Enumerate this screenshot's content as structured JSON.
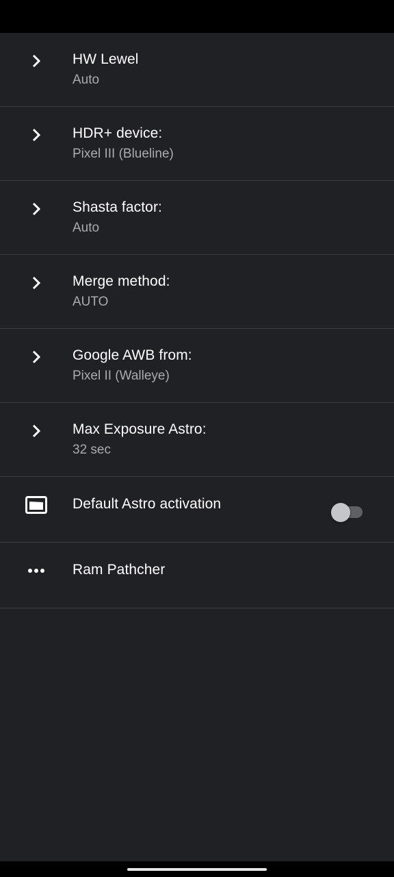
{
  "preferences": [
    {
      "title": "HW Lewel",
      "summary": "Auto",
      "icon": "chevron-right-icon"
    },
    {
      "title": "HDR+ device:",
      "summary": "Pixel III (Blueline)",
      "icon": "chevron-right-icon"
    },
    {
      "title": "Shasta factor:",
      "summary": "Auto",
      "icon": "chevron-right-icon"
    },
    {
      "title": "Merge method:",
      "summary": "AUTO",
      "icon": "chevron-right-icon"
    },
    {
      "title": "Google AWB from:",
      "summary": "Pixel II (Walleye)",
      "icon": "chevron-right-icon"
    },
    {
      "title": "Max Exposure Astro:",
      "summary": "32 sec",
      "icon": "chevron-right-icon"
    },
    {
      "title": "Default Astro activation",
      "icon": "photo-frame-icon",
      "toggle_on": false
    },
    {
      "title": "Ram Pathcher",
      "icon": "more-horiz-icon"
    }
  ],
  "colors": {
    "background": "#202124",
    "divider": "#3c3d40",
    "title_text": "#ffffff",
    "summary_text": "#a8abaf",
    "bars": "#000000"
  }
}
